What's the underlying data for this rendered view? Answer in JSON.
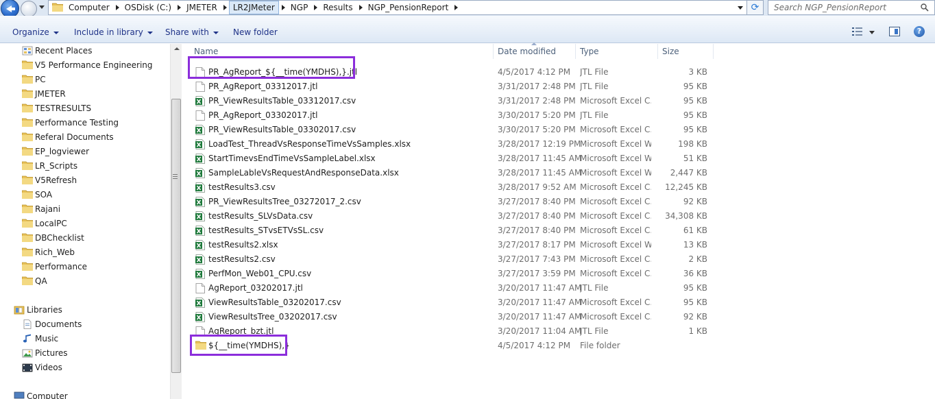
{
  "address": {
    "crumbs": [
      {
        "label": "Computer"
      },
      {
        "label": "OSDisk (C:)"
      },
      {
        "label": "JMETER"
      },
      {
        "label": "LR2JMeter"
      },
      {
        "label": "NGP"
      },
      {
        "label": "Results"
      },
      {
        "label": "NGP_PensionReport"
      }
    ],
    "search_placeholder": "Search NGP_PensionReport"
  },
  "toolbar": {
    "organize": "Organize",
    "include_in_library": "Include in library",
    "share_with": "Share with",
    "new_folder": "New folder"
  },
  "nav": {
    "favorites": [
      "Recent Places",
      "V5 Performance Engineering",
      "PC",
      "JMETER",
      "TESTRESULTS",
      "Performance Testing",
      "Referal Documents",
      "EP_logviewer",
      "LR_Scripts",
      "V5Refresh",
      "SOA",
      "Rajani",
      "LocalPC",
      "DBChecklist",
      "Rich_Web",
      "Performance",
      "QA"
    ],
    "libraries_label": "Libraries",
    "libraries": [
      "Documents",
      "Music",
      "Pictures",
      "Videos"
    ],
    "computer_label": "Computer"
  },
  "columns": {
    "name": "Name",
    "date": "Date modified",
    "type": "Type",
    "size": "Size"
  },
  "files": [
    {
      "name": "PR_AgReport_${__time(YMDHS),}.jtl",
      "date": "4/5/2017 4:12 PM",
      "type": "JTL File",
      "size": "3 KB",
      "icon": "file-icon"
    },
    {
      "name": "PR_AgReport_03312017.jtl",
      "date": "3/31/2017 2:48 PM",
      "type": "JTL File",
      "size": "95 KB",
      "icon": "file-icon"
    },
    {
      "name": "PR_ViewResultsTable_03312017.csv",
      "date": "3/31/2017 2:48 PM",
      "type": "Microsoft Excel C...",
      "size": "95 KB",
      "icon": "excel-icon"
    },
    {
      "name": "PR_AgReport_03302017.jtl",
      "date": "3/30/2017 5:20 PM",
      "type": "JTL File",
      "size": "95 KB",
      "icon": "file-icon"
    },
    {
      "name": "PR_ViewResultsTable_03302017.csv",
      "date": "3/30/2017 5:20 PM",
      "type": "Microsoft Excel C...",
      "size": "95 KB",
      "icon": "excel-icon"
    },
    {
      "name": "LoadTest_ThreadVsResponseTimeVsSamples.xlsx",
      "date": "3/28/2017 12:19 PM",
      "type": "Microsoft Excel W...",
      "size": "198 KB",
      "icon": "excel-icon"
    },
    {
      "name": "StartTimevsEndTimeVsSampleLabel.xlsx",
      "date": "3/28/2017 11:45 AM",
      "type": "Microsoft Excel W...",
      "size": "51 KB",
      "icon": "excel-icon"
    },
    {
      "name": "SampleLableVsRequestAndResponseData.xlsx",
      "date": "3/28/2017 11:45 AM",
      "type": "Microsoft Excel W...",
      "size": "2,447 KB",
      "icon": "excel-icon"
    },
    {
      "name": "testResults3.csv",
      "date": "3/28/2017 9:52 AM",
      "type": "Microsoft Excel C...",
      "size": "12,245 KB",
      "icon": "excel-icon"
    },
    {
      "name": "PR_ViewResultsTree_03272017_2.csv",
      "date": "3/27/2017 8:40 PM",
      "type": "Microsoft Excel C...",
      "size": "92 KB",
      "icon": "excel-icon"
    },
    {
      "name": "testResults_SLVsData.csv",
      "date": "3/27/2017 8:40 PM",
      "type": "Microsoft Excel C...",
      "size": "34,308 KB",
      "icon": "excel-icon"
    },
    {
      "name": "testResults_STvsETVsSL.csv",
      "date": "3/27/2017 8:40 PM",
      "type": "Microsoft Excel C...",
      "size": "61 KB",
      "icon": "excel-icon"
    },
    {
      "name": "testResults2.xlsx",
      "date": "3/27/2017 8:17 PM",
      "type": "Microsoft Excel W...",
      "size": "13 KB",
      "icon": "excel-icon"
    },
    {
      "name": "testResults2.csv",
      "date": "3/27/2017 7:43 PM",
      "type": "Microsoft Excel C...",
      "size": "2 KB",
      "icon": "excel-icon"
    },
    {
      "name": "PerfMon_Web01_CPU.csv",
      "date": "3/27/2017 3:59 PM",
      "type": "Microsoft Excel C...",
      "size": "36 KB",
      "icon": "excel-icon"
    },
    {
      "name": "AgReport_03202017.jtl",
      "date": "3/20/2017 11:47 AM",
      "type": "JTL File",
      "size": "95 KB",
      "icon": "file-icon"
    },
    {
      "name": "ViewResultsTable_03202017.csv",
      "date": "3/20/2017 11:47 AM",
      "type": "Microsoft Excel C...",
      "size": "95 KB",
      "icon": "excel-icon"
    },
    {
      "name": "ViewResultsTree_03202017.csv",
      "date": "3/20/2017 11:47 AM",
      "type": "Microsoft Excel C...",
      "size": "92 KB",
      "icon": "excel-icon"
    },
    {
      "name": "AgReport_bzt.jtl",
      "date": "3/20/2017 11:04 AM",
      "type": "JTL File",
      "size": "1 KB",
      "icon": "file-icon"
    },
    {
      "name": "${__time(YMDHS),}",
      "date": "4/5/2017 4:12 PM",
      "type": "File folder",
      "size": "",
      "icon": "folder-icon"
    }
  ],
  "colors": {
    "highlight": "#8b2ddb",
    "folder": "#e8c25a",
    "excel": "#1f7a3c"
  }
}
